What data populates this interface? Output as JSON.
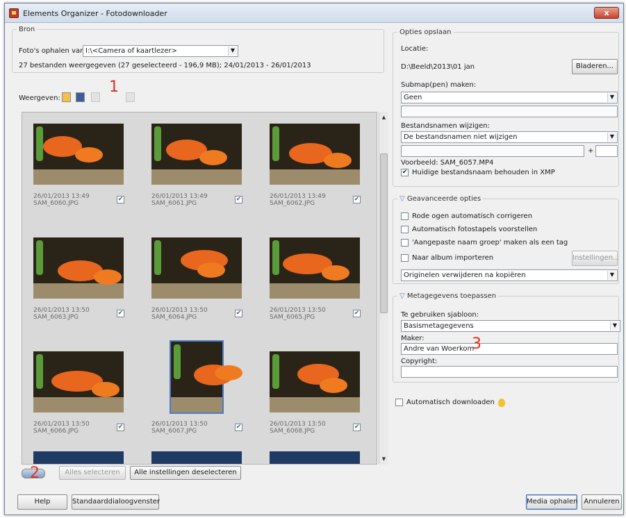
{
  "window": {
    "title": "Elements Organizer - Fotodownloader",
    "close_label": "x"
  },
  "source": {
    "legend": "Bron",
    "get_from_label": "Foto's ophalen van:",
    "get_from_value": "I:\\<Camera of kaartlezer>",
    "summary": "27 bestanden weergegeven (27 geselecteerd - 196,9 MB); 24/01/2013 - 26/01/2013"
  },
  "view": {
    "label": "Weergeven:"
  },
  "annotations": {
    "one": "1",
    "two": "2",
    "three": "3"
  },
  "thumbnails": [
    {
      "date": "26/01/2013 13:49",
      "name": "SAM_6060.JPG",
      "checked": true
    },
    {
      "date": "26/01/2013 13:49",
      "name": "SAM_6061.JPG",
      "checked": true
    },
    {
      "date": "26/01/2013 13:49",
      "name": "SAM_6062.JPG",
      "checked": true
    },
    {
      "date": "26/01/2013 13:50",
      "name": "SAM_6063.JPG",
      "checked": true
    },
    {
      "date": "26/01/2013 13:50",
      "name": "SAM_6064.JPG",
      "checked": true
    },
    {
      "date": "26/01/2013 13:50",
      "name": "SAM_6065.JPG",
      "checked": true
    },
    {
      "date": "26/01/2013 13:50",
      "name": "SAM_6066.JPG",
      "checked": true
    },
    {
      "date": "26/01/2013 13:50",
      "name": "SAM_6067.JPG",
      "checked": true
    },
    {
      "date": "26/01/2013 13:50",
      "name": "SAM_6068.JPG",
      "checked": true
    }
  ],
  "grid_footer": {
    "select_all": "Alles selecteren",
    "deselect_all": "Alle instellingen deselecteren"
  },
  "save_options": {
    "legend": "Opties opslaan",
    "location_label": "Locatie:",
    "location_value": "D:\\Beeld\\2013\\01 jan",
    "browse_button": "Bladeren...",
    "subfolder_label": "Submap(pen) maken:",
    "subfolder_value": "Geen",
    "rename_label": "Bestandsnamen wijzigen:",
    "rename_value": "De bestandsnamen niet wijzigen",
    "plus": "+",
    "example": "Voorbeeld: SAM_6057.MP4",
    "keep_name_label": "Huidige bestandsnaam behouden in XMP",
    "keep_name_checked": true
  },
  "advanced": {
    "legend": "Geavanceerde opties",
    "red_eye": "Rode ogen automatisch corrigeren",
    "stacks": "Automatisch fotostapels voorstellen",
    "custom_group_tag": "'Aangepaste naam groep' maken als een tag",
    "import_album": "Naar album importeren",
    "settings_button": "Instellingen...",
    "after_copy_value": "Originelen verwijderen na kopiëren"
  },
  "metadata": {
    "legend": "Metagegevens toepassen",
    "template_label": "Te gebruiken sjabloon:",
    "template_value": "Basismetagegevens",
    "author_label": "Maker:",
    "author_value": "Andre van Woerkom",
    "copyright_label": "Copyright:",
    "copyright_value": ""
  },
  "auto_download": {
    "label": "Automatisch downloaden"
  },
  "bottom": {
    "help_button": "Help",
    "standard_button": "Standaarddialoogvenster",
    "get_media_button": "Media ophalen",
    "cancel_button": "Annuleren"
  },
  "colors": {
    "accent_red": "#e03020",
    "selection_blue": "#4a7cc4",
    "title_bar": "#cfdceb"
  }
}
